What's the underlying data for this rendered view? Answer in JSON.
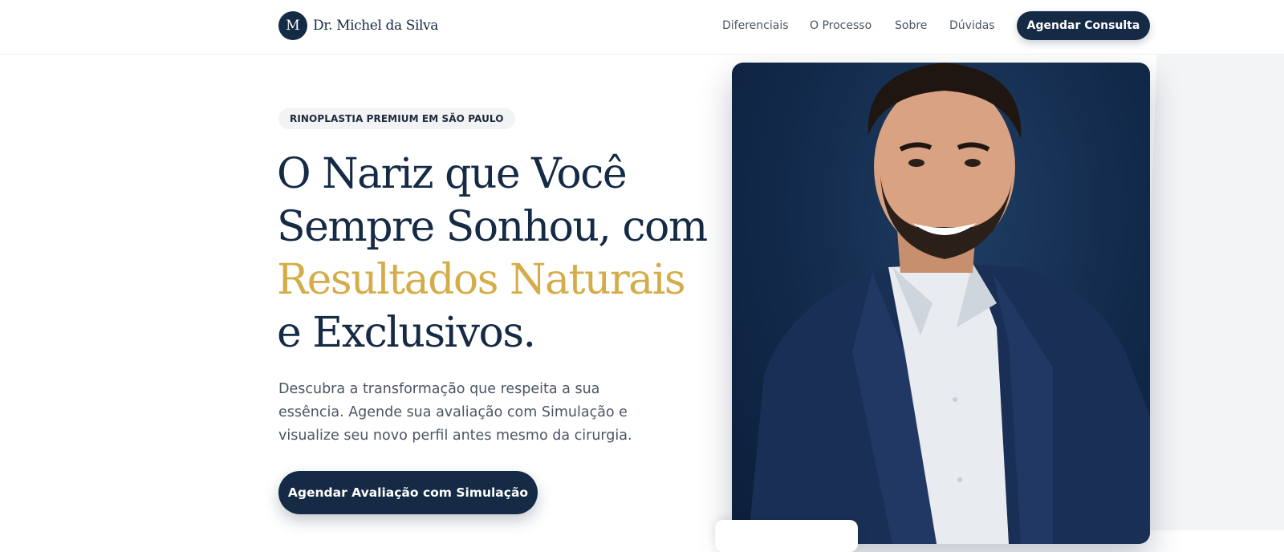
{
  "header": {
    "logo_mark": "M",
    "brand": "Dr. Michel da Silva",
    "nav": [
      "Diferenciais",
      "O Processo",
      "Sobre",
      "Dúvidas"
    ],
    "cta_label": "Agendar Consulta"
  },
  "hero": {
    "eyebrow": "RINOPLASTIA PREMIUM EM SÃO PAULO",
    "headline": {
      "line1": "O Nariz que Você",
      "line2": "Sempre Sonhou, com",
      "highlight": "Resultados Naturais",
      "line4": "e Exclusivos."
    },
    "lead": [
      "Descubra a transformação que respeita a sua",
      "essência. Agende sua avaliação com Simulação e",
      "visualize seu novo perfil antes mesmo da cirurgia."
    ],
    "cta_label": "Agendar Avaliação com Simulação"
  },
  "colors": {
    "navy": "#152a45",
    "gold": "#d4ad4a",
    "muted_text": "#4b5563",
    "photo_bg": "#12294a"
  }
}
